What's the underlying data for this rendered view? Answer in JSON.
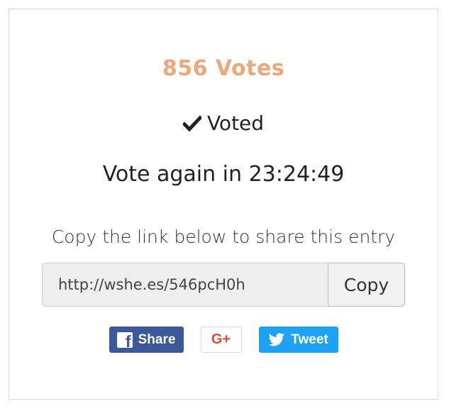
{
  "entry": {
    "votes_label": "856 Votes",
    "voted_label": "Voted",
    "vote_again_label": "Vote again in 23:24:49",
    "share_hint": "Copy the link below to share this entry",
    "link_value": "http://wshe.es/546pcH0h",
    "copy_label": "Copy"
  },
  "social": {
    "facebook_label": "Share",
    "googleplus_label": "G+",
    "twitter_label": "Tweet"
  },
  "colors": {
    "votes": "#eda77a",
    "facebook": "#3b5998",
    "googleplus": "#dd4b39",
    "twitter": "#1da1f2"
  },
  "icons": [
    "check-icon",
    "facebook-icon",
    "twitter-icon"
  ]
}
